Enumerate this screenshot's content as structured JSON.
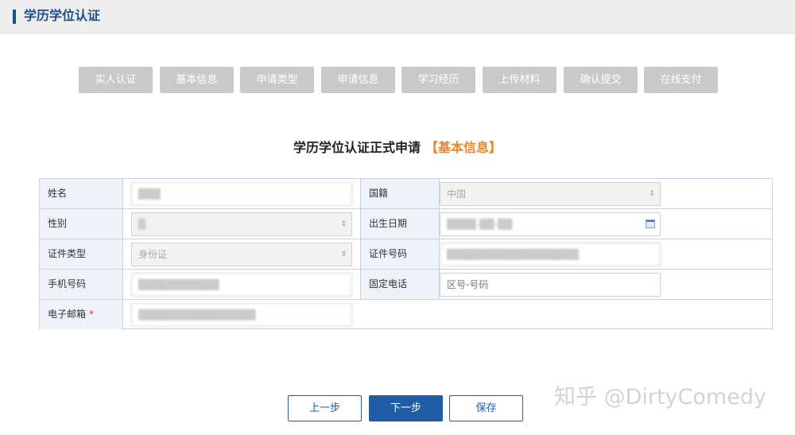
{
  "header": {
    "title": "学历学位认证"
  },
  "steps": [
    "实人认证",
    "基本信息",
    "申请类型",
    "申请信息",
    "学习经历",
    "上传材料",
    "确认提交",
    "在线支付"
  ],
  "heading": {
    "text": "学历学位认证正式申请",
    "highlight": "【基本信息】"
  },
  "form": {
    "name_label": "姓名",
    "name_value": "▒▒▒",
    "nationality_label": "国籍",
    "nationality_value": "中国",
    "gender_label": "性别",
    "gender_value": "▒",
    "birthdate_label": "出生日期",
    "birthdate_value": "▒▒▒▒-▒▒-▒▒",
    "id_type_label": "证件类型",
    "id_type_value": "身份证",
    "id_number_label": "证件号码",
    "id_number_value": "▒▒▒▒▒▒▒▒▒▒▒▒▒▒▒▒▒▒",
    "mobile_label": "手机号码",
    "mobile_value": "▒▒▒▒▒▒▒▒▒▒▒",
    "landline_label": "固定电话",
    "landline_placeholder": "区号-号码",
    "email_label": "电子邮箱",
    "email_required": "*",
    "email_value": "▒▒▒▒▒▒▒▒▒▒▒▒▒▒▒▒"
  },
  "buttons": {
    "prev": "上一步",
    "next": "下一步",
    "save": "保存"
  },
  "watermark": "知乎 @DirtyComedy",
  "icons": {
    "select_arrow": "⇕",
    "calendar": "calendar-icon"
  },
  "colors": {
    "brand": "#1f5da6",
    "highlight": "#e9862a",
    "step_bg": "#c9c9c9",
    "label_bg": "#eef2f9"
  }
}
